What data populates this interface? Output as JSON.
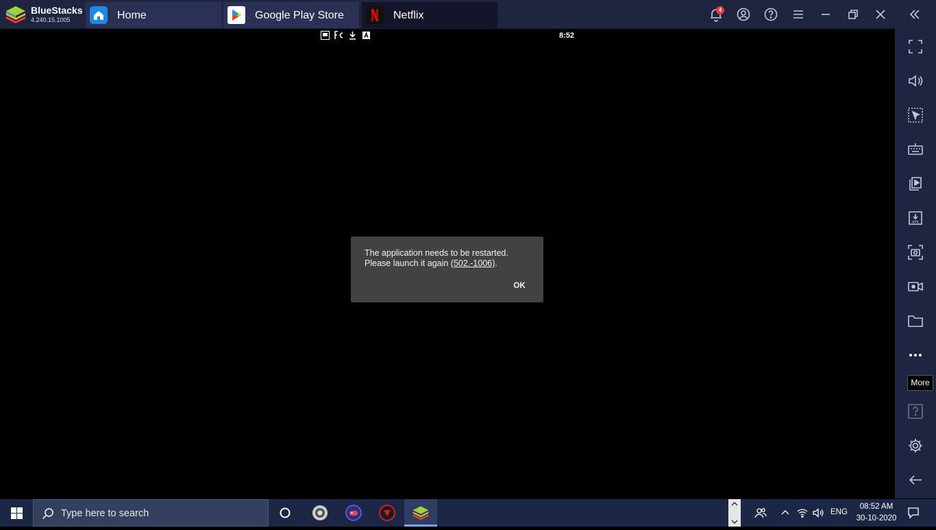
{
  "app": {
    "name": "BlueStacks",
    "version": "4.240.15.1005"
  },
  "tabs": [
    {
      "label": "Home",
      "icon": "home-icon",
      "active": false
    },
    {
      "label": "Google Play Store",
      "icon": "play-store-icon",
      "active": false
    },
    {
      "label": "Netflix",
      "icon": "netflix-icon",
      "active": true
    }
  ],
  "titlebar": {
    "notification_count": "4",
    "icons": [
      "bell-icon",
      "account-icon",
      "help-icon",
      "menu-icon",
      "minimize-icon",
      "restore-icon",
      "close-icon",
      "collapse-sidebar-icon"
    ]
  },
  "android": {
    "status_time": "8:52",
    "status_icons": [
      "screenshot-icon",
      "fc-icon",
      "download-icon",
      "a-icon"
    ]
  },
  "dialog": {
    "line1": "The application needs to be restarted.",
    "line2_prefix": "Please launch it again ",
    "error_code": "(502.-1006)",
    "line2_suffix": ".",
    "ok_label": "OK"
  },
  "sidebar": {
    "buttons": [
      "fullscreen-icon",
      "volume-icon",
      "select-area-icon",
      "keyboard-icon",
      "media-manager-icon",
      "install-apk-icon",
      "screenshot-icon",
      "record-icon",
      "folder-icon",
      "more-icon",
      "help-icon",
      "settings-icon",
      "back-icon"
    ],
    "tooltip": "More"
  },
  "taskbar": {
    "search_placeholder": "Type here to search",
    "language": "ENG",
    "time": "08:52 AM",
    "date": "30-10-2020"
  },
  "colors": {
    "titlebar_bg": "#1f2440",
    "tab_bg": "#2b3155",
    "active_tab_bg": "#131628",
    "dialog_bg": "#424242",
    "taskbar_bg": "#1c2746",
    "netflix_red": "#e50914",
    "badge_red": "#e83a3a"
  }
}
